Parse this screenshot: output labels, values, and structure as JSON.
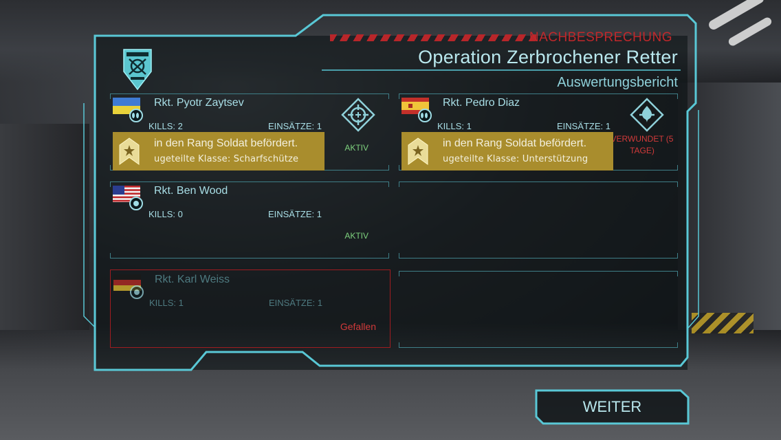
{
  "header": {
    "label": "NACHBESPRECHUNG",
    "title": "Operation Zerbrochener Retter",
    "subtitle": "Auswertungsbericht"
  },
  "colors": {
    "accent": "#59c8d6",
    "alert": "#c0282b",
    "promo": "#a98d2d",
    "active": "#7fd37f"
  },
  "soldiers": [
    {
      "name": "Rkt. Pyotr Zaytsev",
      "flag": "ukraine",
      "kills": "KILLS: 2",
      "missions": "EINSÄTZE: 1",
      "status": "AKTIV",
      "class_icon": "crosshair-icon",
      "promo_line1": "in den Rang Soldat befördert.",
      "promo_line2": "ugeteilte Klasse: Scharfschütze"
    },
    {
      "name": "Rkt. Pedro Diaz",
      "flag": "spain",
      "kills": "KILLS: 1",
      "missions": "EINSÄTZE: 1",
      "status": "VERWUNDET (5 TAGE)",
      "class_icon": "support-icon",
      "promo_line1": "in den Rang Soldat befördert.",
      "promo_line2": "ugeteilte Klasse: Unterstützung"
    },
    {
      "name": "Rkt. Ben Wood",
      "flag": "usa",
      "kills": "KILLS: 0",
      "missions": "EINSÄTZE: 1",
      "status": "AKTIV"
    },
    {
      "name": "Rkt. Karl Weiss",
      "flag": "germany",
      "kills": "KILLS: 1",
      "missions": "EINSÄTZE: 1",
      "status": "Gefallen"
    }
  ],
  "continue_label": "WEITER"
}
